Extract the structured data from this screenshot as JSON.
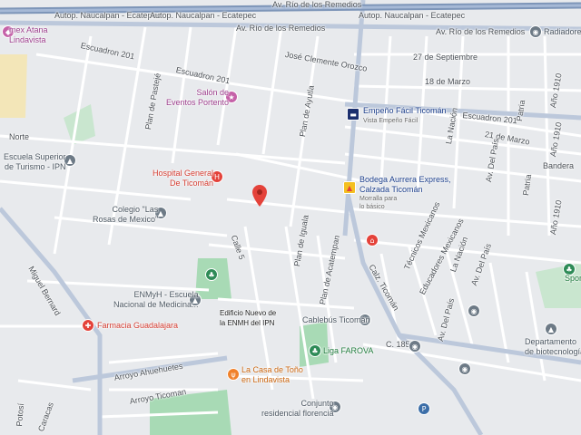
{
  "colors": {
    "background": "#e8eaed",
    "road": "#ffffff",
    "major_road": "#bcc8db",
    "highway": "#7d95b8",
    "park": "#a8dab5",
    "block": "#dde1e6",
    "pin_red": "#e4423a",
    "poi_blue": "#3b6ea8",
    "poi_red": "#e4423a",
    "poi_green": "#2e8b57",
    "poi_orange": "#f0812b",
    "poi_pink": "#c561a8",
    "poi_gray": "#6d7a86"
  },
  "streets": {
    "autop_1": "Autop. Naucalpan - Ecatepec",
    "autop_2": "Autop. Naucalpan - Ecatepec",
    "rio_remedios_1": "Av. Río de los Remedios",
    "rio_remedios_2": "Av. Río de los Remedios",
    "rio_remedios_3": "Av. Río de los Remedios",
    "escuadron_201_a": "Escuadron 201",
    "escuadron_201_b": "Escuadron 201",
    "escuadron_201_c": "Escuadron 201",
    "jose_clemente": "José Clemente Orozco",
    "septiembre": "27 de Septiembre",
    "marzo_18": "18 de Marzo",
    "marzo_21": "21 de Marzo",
    "bandera": "Bandera",
    "ano1910_a": "Año 1910",
    "ano1910_b": "Año 1910",
    "ano1910_c": "Año 1910",
    "patria_a": "Patria",
    "patria_b": "Patria",
    "la_nacion": "La Nación",
    "del_pais": "Av. Del País",
    "del_pais_2": "Av. Del País",
    "del_pais_3": "Av. Del País",
    "norte": "Norte",
    "plan_pastejhe": "Plan de Pastejé",
    "plan_ayutla": "Plan de Ayutla",
    "plan_iguala": "Plan de Iguala",
    "plan_acatempan": "Plan de Acatempan",
    "calle5": "Calle 5",
    "calz_ticoman": "Calz. Ticomán",
    "c1857": "C. 1857",
    "tecnicos": "Técnicos Mexicanos",
    "educadores": "Educadores Mexicanos",
    "la_nacion_2": "La Nación",
    "miguel_bernard": "Miguel Bernard",
    "arroyo_ahuehuetes": "Arroyo Ahuehuetes",
    "arroyo_ticoman": "Arroyo Ticoman",
    "potosi": "Potosí",
    "caracas": "Caracas"
  },
  "pois": {
    "homex": "mex Atana\nLindavista",
    "escuela_turismo": "Escuela Superior\nde Turismo - IPN",
    "salon": "Salón de\nEventos Portento",
    "hospital": "Hospital General\nDe Ticomán",
    "colegio": "Colegio \"Las\nRosas de Mexico\"",
    "enmyh": "ENMyH - Escuela\nNacional de Medicina...",
    "edificio": "Edificio Nuevo de\nla ENMH del IPN",
    "farmacia": "Farmacia Guadalajara",
    "empeno": "Empeño Fácil Ticomán",
    "empeno_sub": "Vista Empeño Fácil",
    "bodega": "Bodega Aurrera Express,\nCalzada Ticomán",
    "bodega_sub": "Morralla para\nlo básico",
    "cablebus": "Cablebús Ticomán",
    "liga": "Liga FAROVA",
    "casa_tono": "La Casa de Toño\nen Lindavista",
    "conjunto": "Conjunto\nresidencial florencia",
    "departamento": "Departamento\nde biotecnología...",
    "radiadores": "Radiadores",
    "spor": "Spor"
  }
}
